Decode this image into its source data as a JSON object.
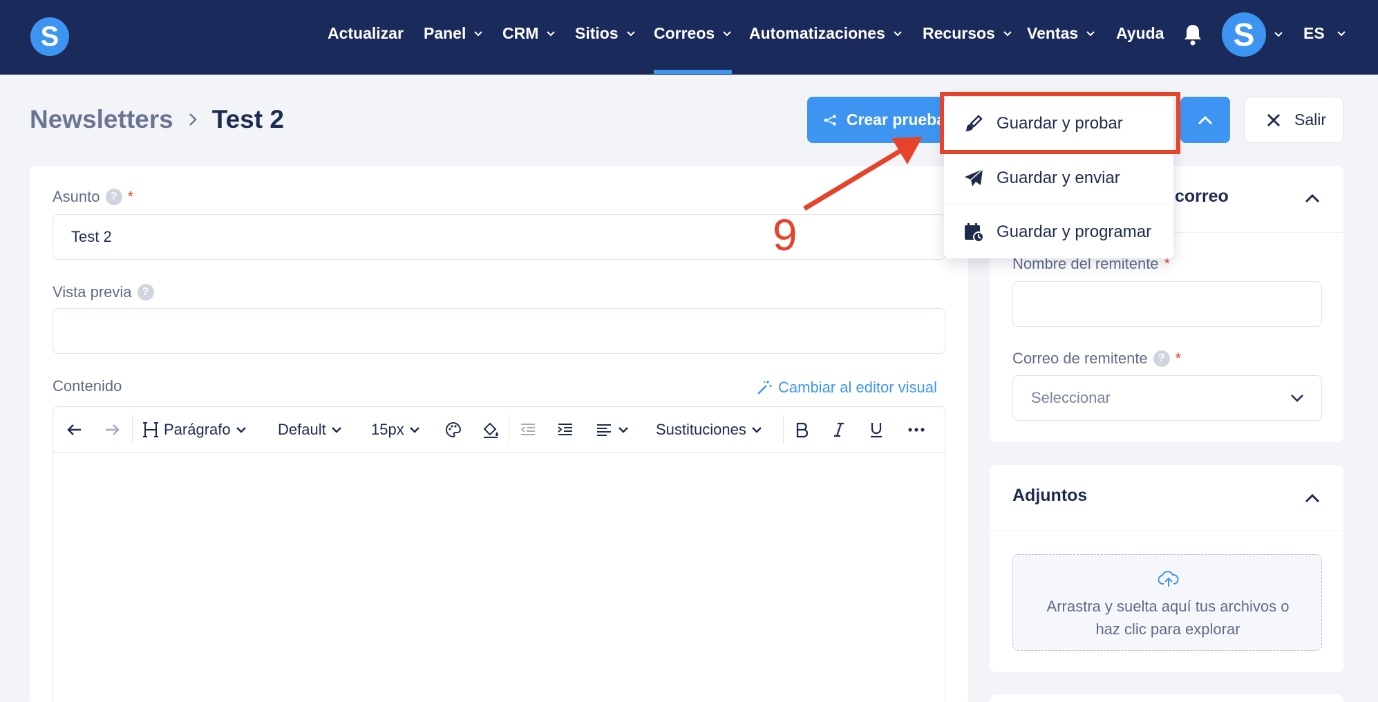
{
  "nav": {
    "items": [
      {
        "label": "Actualizar"
      },
      {
        "label": "Panel"
      },
      {
        "label": "CRM"
      },
      {
        "label": "Sitios"
      },
      {
        "label": "Correos"
      },
      {
        "label": "Automatizaciones"
      },
      {
        "label": "Recursos"
      },
      {
        "label": "Ventas"
      },
      {
        "label": "Ayuda"
      }
    ],
    "active": "Correos",
    "logo_letter": "S",
    "avatar_letter": "S",
    "language": "ES"
  },
  "breadcrumb": {
    "parent": "Newsletters",
    "current": "Test 2"
  },
  "actions": {
    "create_test": "Crear prueba",
    "exit": "Salir"
  },
  "save_menu": {
    "items": [
      {
        "label": "Guardar y probar",
        "icon": "brush-icon"
      },
      {
        "label": "Guardar y enviar",
        "icon": "paper-plane-icon"
      },
      {
        "label": "Guardar y programar",
        "icon": "calendar-clock-icon"
      }
    ],
    "highlighted": "Guardar y probar"
  },
  "annotation": {
    "step": "9",
    "color": "#e5432a"
  },
  "form": {
    "subject_label": "Asunto",
    "subject_value": "Test 2",
    "preview_label": "Vista previa",
    "preview_value": "",
    "content_label": "Contenido",
    "visual_editor_link": "Cambiar al editor visual"
  },
  "editor_toolbar": {
    "paragraph": "Parágrafo",
    "font": "Default",
    "size": "15px",
    "substitutions": "Sustituciones"
  },
  "sender_card": {
    "title_fragment": "correo",
    "sender_name_label": "Nombre del remitente",
    "sender_name_value": "",
    "sender_email_label": "Correo de remitente",
    "sender_email_placeholder": "Seleccionar"
  },
  "attachments_card": {
    "title": "Adjuntos",
    "drop_line1": "Arrastra y suelta aquí tus archivos o",
    "drop_line2": "haz clic para explorar"
  },
  "colors": {
    "nav_bg": "#1a2a5a",
    "accent": "#3d95f1",
    "annotation": "#e5432a",
    "page_bg": "#f3f4f8"
  }
}
